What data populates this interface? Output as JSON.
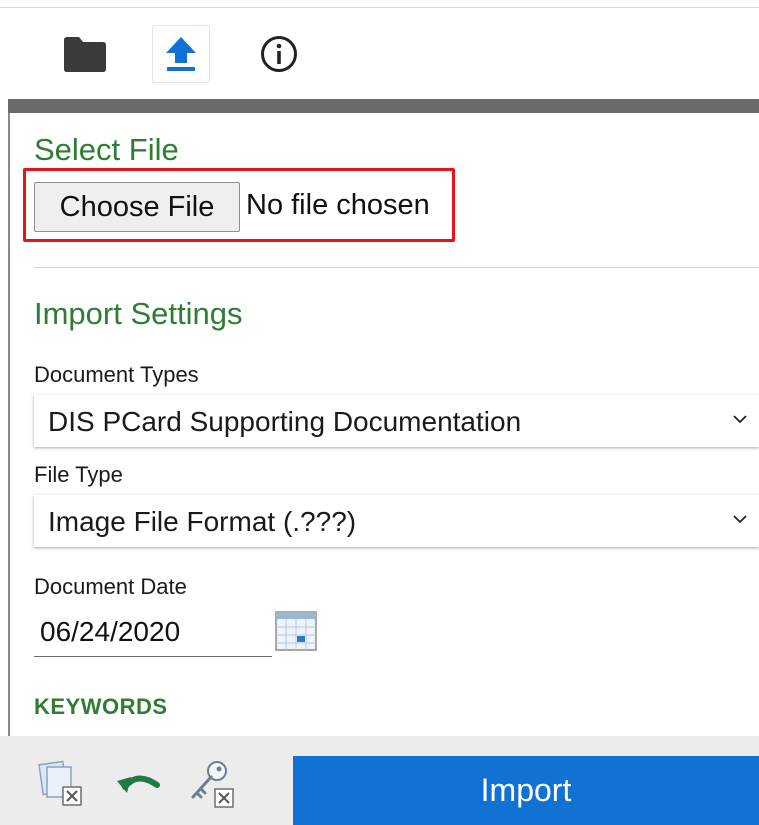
{
  "toolbar": {
    "items": [
      {
        "name": "folder",
        "icon": "folder-icon"
      },
      {
        "name": "upload",
        "icon": "upload-icon",
        "selected": true
      },
      {
        "name": "info",
        "icon": "info-icon"
      }
    ]
  },
  "select_file": {
    "title": "Select File",
    "choose_button_label": "Choose File",
    "status_text": "No file chosen"
  },
  "import_settings": {
    "title": "Import Settings",
    "document_types": {
      "label": "Document Types",
      "value": "DIS PCard Supporting Documentation"
    },
    "file_type": {
      "label": "File Type",
      "value": "Image File Format (.???)"
    },
    "document_date": {
      "label": "Document Date",
      "value": "06/24/2020"
    },
    "keywords_heading": "KEYWORDS"
  },
  "footer": {
    "icons": [
      "documents-clear-icon",
      "undo-icon",
      "key-clear-icon"
    ],
    "import_label": "Import"
  },
  "colors": {
    "accent_green": "#2e7d32",
    "primary_blue": "#1172d4",
    "highlight_red": "#e8121a"
  }
}
